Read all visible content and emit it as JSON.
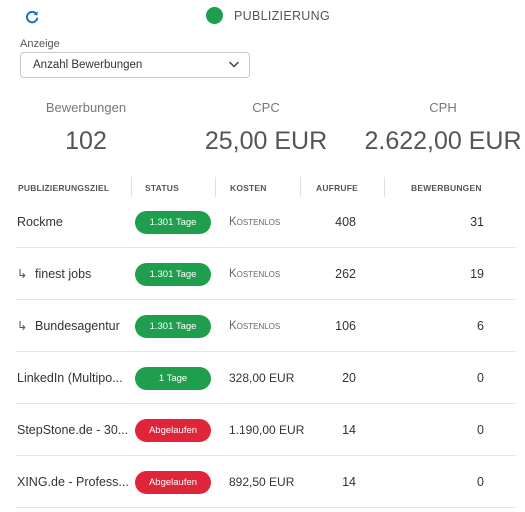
{
  "header": {
    "status_title": "PUBLIZIERUNG",
    "status_color": "#1f9e4e",
    "accent_color": "#1a73c8"
  },
  "filter": {
    "label": "Anzeige",
    "selected": "Anzahl Bewerbungen"
  },
  "metrics": [
    {
      "label": "Bewerbungen",
      "value": "102"
    },
    {
      "label": "CPC",
      "value": "25,00 EUR"
    },
    {
      "label": "CPH",
      "value": "2.622,00 EUR"
    }
  ],
  "table": {
    "headers": [
      "PUBLIZIERUNGSZIEL",
      "STATUS",
      "KOSTEN",
      "AUFRUFE",
      "BEWERBUNGEN"
    ],
    "rows": [
      {
        "name": "Rockme",
        "sub": false,
        "status": "1.301 Tage",
        "status_type": "green",
        "cost": "Kostenlos",
        "cost_free": true,
        "aufrufe": "408",
        "bewerbungen": "31"
      },
      {
        "name": "finest jobs",
        "sub": true,
        "status": "1.301 Tage",
        "status_type": "green",
        "cost": "Kostenlos",
        "cost_free": true,
        "aufrufe": "262",
        "bewerbungen": "19"
      },
      {
        "name": "Bundesagentur",
        "sub": true,
        "status": "1.301 Tage",
        "status_type": "green",
        "cost": "Kostenlos",
        "cost_free": true,
        "aufrufe": "106",
        "bewerbungen": "6"
      },
      {
        "name": "LinkedIn (Multipo...",
        "sub": false,
        "status": "1 Tage",
        "status_type": "green",
        "cost": "328,00 EUR",
        "cost_free": false,
        "aufrufe": "20",
        "bewerbungen": "0"
      },
      {
        "name": "StepStone.de - 30...",
        "sub": false,
        "status": "Abgelaufen",
        "status_type": "red",
        "cost": "1.190,00 EUR",
        "cost_free": false,
        "aufrufe": "14",
        "bewerbungen": "0"
      },
      {
        "name": "XING.de - Profess...",
        "sub": false,
        "status": "Abgelaufen",
        "status_type": "red",
        "cost": "892,50 EUR",
        "cost_free": false,
        "aufrufe": "14",
        "bewerbungen": "0"
      }
    ]
  }
}
